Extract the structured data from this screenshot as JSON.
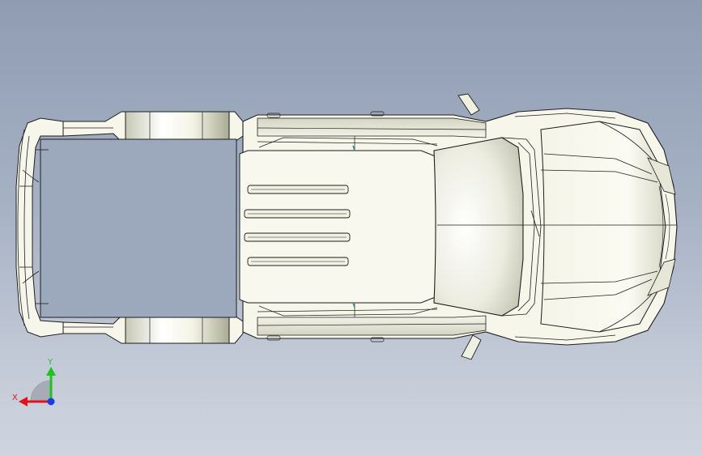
{
  "viewport": {
    "background_top": "#8f9cb2",
    "background_bottom": "#cfd5df"
  },
  "model": {
    "view": "top",
    "body_fill": "#f6f6ea",
    "edge_color": "#1e1e1e",
    "shade_color": "#bfc0ae"
  },
  "triad": {
    "x_label": "X",
    "y_label": "Y",
    "x_color": "#e0141a",
    "y_color": "#1fc21f",
    "z_color": "#1a3de0"
  }
}
